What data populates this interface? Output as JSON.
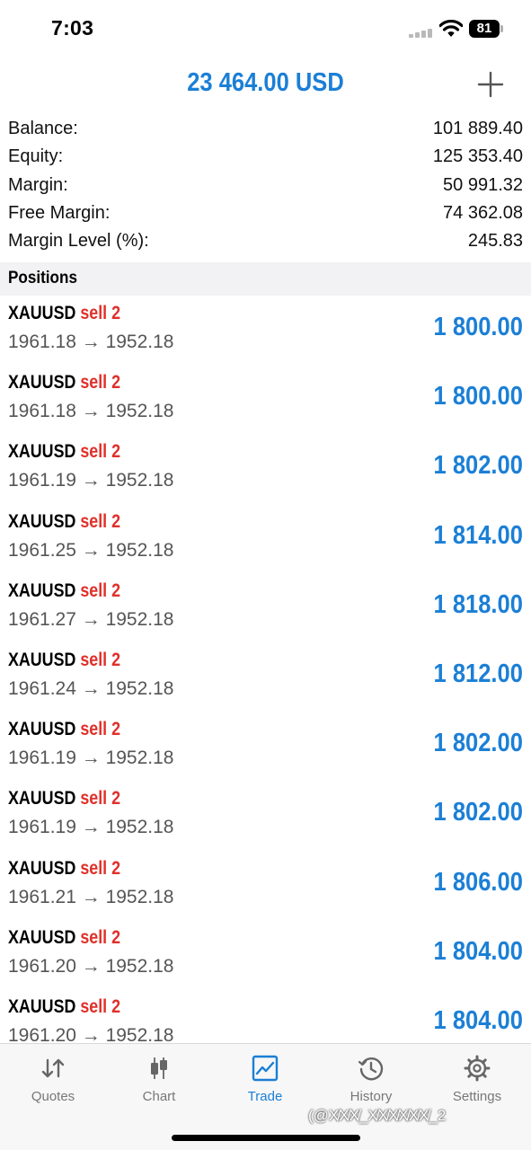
{
  "status_bar": {
    "time": "7:03",
    "battery": "81"
  },
  "header": {
    "title": "23 464.00 USD"
  },
  "summary": [
    {
      "label": "Balance:",
      "value": "101 889.40"
    },
    {
      "label": "Equity:",
      "value": "125 353.40"
    },
    {
      "label": "Margin:",
      "value": "50 991.32"
    },
    {
      "label": "Free Margin:",
      "value": "74 362.08"
    },
    {
      "label": "Margin Level (%):",
      "value": "245.83"
    }
  ],
  "positions_title": "Positions",
  "positions": [
    {
      "symbol": "XAUUSD",
      "side": "sell 2",
      "prices": "1961.18 → 1952.18",
      "profit": "1 800.00"
    },
    {
      "symbol": "XAUUSD",
      "side": "sell 2",
      "prices": "1961.18 → 1952.18",
      "profit": "1 800.00"
    },
    {
      "symbol": "XAUUSD",
      "side": "sell 2",
      "prices": "1961.19 → 1952.18",
      "profit": "1 802.00"
    },
    {
      "symbol": "XAUUSD",
      "side": "sell 2",
      "prices": "1961.25 → 1952.18",
      "profit": "1 814.00"
    },
    {
      "symbol": "XAUUSD",
      "side": "sell 2",
      "prices": "1961.27 → 1952.18",
      "profit": "1 818.00"
    },
    {
      "symbol": "XAUUSD",
      "side": "sell 2",
      "prices": "1961.24 → 1952.18",
      "profit": "1 812.00"
    },
    {
      "symbol": "XAUUSD",
      "side": "sell 2",
      "prices": "1961.19 → 1952.18",
      "profit": "1 802.00"
    },
    {
      "symbol": "XAUUSD",
      "side": "sell 2",
      "prices": "1961.19 → 1952.18",
      "profit": "1 802.00"
    },
    {
      "symbol": "XAUUSD",
      "side": "sell 2",
      "prices": "1961.21 → 1952.18",
      "profit": "1 806.00"
    },
    {
      "symbol": "XAUUSD",
      "side": "sell 2",
      "prices": "1961.20 → 1952.18",
      "profit": "1 804.00"
    },
    {
      "symbol": "XAUUSD",
      "side": "sell 2",
      "prices": "1961.20 → 1952.18",
      "profit": "1 804.00"
    }
  ],
  "tabs": [
    {
      "label": "Quotes",
      "icon": "quotes-arrows-icon"
    },
    {
      "label": "Chart",
      "icon": "candlestick-chart-icon"
    },
    {
      "label": "Trade",
      "icon": "trade-chart-icon",
      "active": true
    },
    {
      "label": "History",
      "icon": "history-clock-icon"
    },
    {
      "label": "Settings",
      "icon": "gear-icon"
    }
  ],
  "watermark": "(@X̸X̸X̸_X̸X̸X̸X̸X̸X̸_2",
  "colors": {
    "accent": "#1b7fd6",
    "sell": "#e0302a",
    "text": "#000000",
    "secondary": "#555555"
  }
}
